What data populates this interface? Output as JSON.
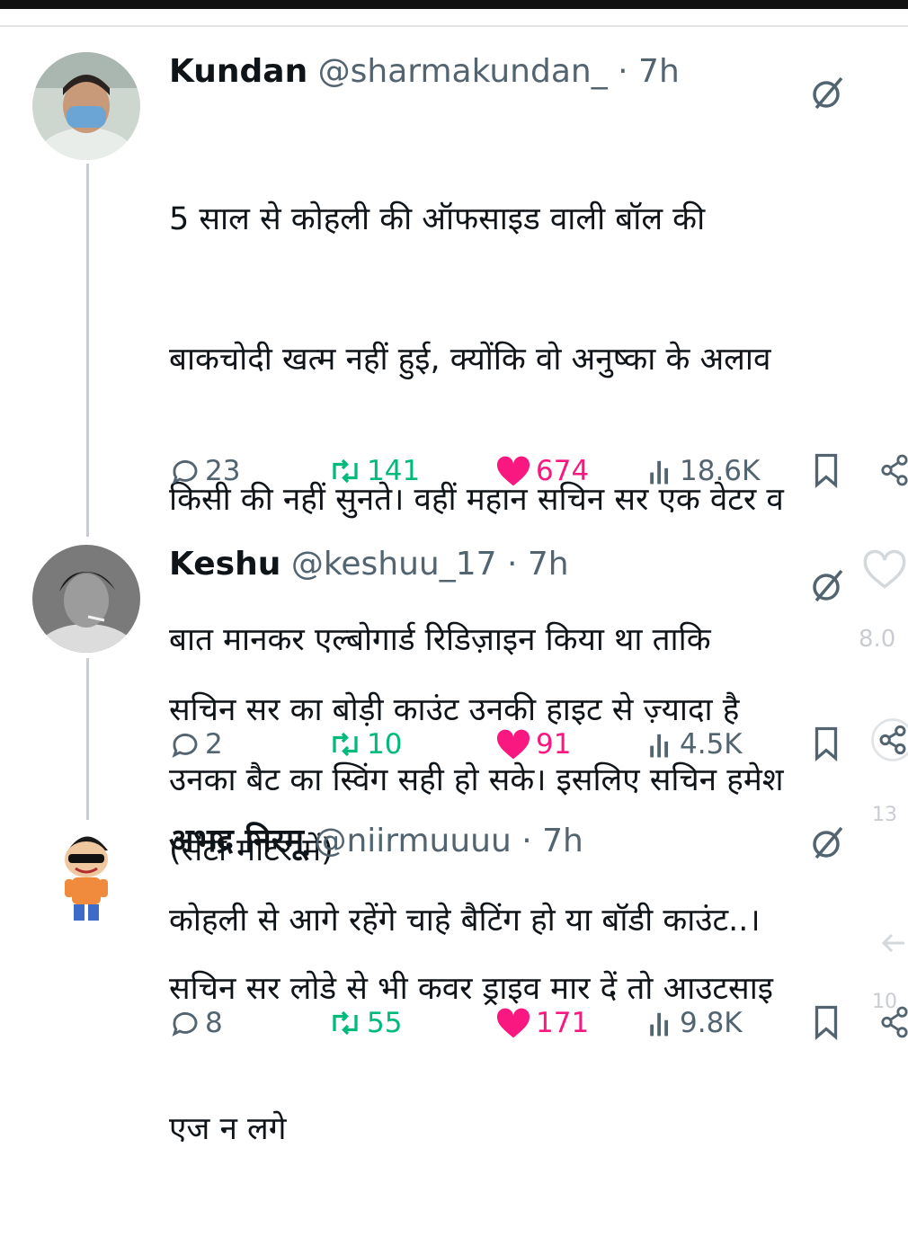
{
  "colors": {
    "like": "#f91880",
    "retweet": "#00ba7c",
    "muted": "#536471",
    "thread_line": "#c9ccd0"
  },
  "tweets": [
    {
      "name": "Kundan",
      "handle": "@sharmakundan_",
      "time": "· 7h",
      "lines": [
        "5 साल से कोहली की ऑफसाइड वाली बॉल की",
        "बाकचोदी खत्म नहीं हुई, क्योंकि वो अनुष्का के अलाव",
        "किसी की नहीं सुनते। वहीं महान सचिन सर एक वेटर व",
        "बात मानकर एल्बोगार्ड रिडिज़ाइन किया था ताकि",
        "उनका बैट का स्विंग सही हो सके। इसलिए सचिन हमेश",
        "कोहली से आगे रहेंगे चाहे बैटिंग हो या बॉडी काउंट..।"
      ],
      "replies": "23",
      "retweets": "141",
      "likes": "674",
      "views": "18.6K"
    },
    {
      "name": "Keshu",
      "handle": "@keshuu_17",
      "time": "· 7h",
      "lines": [
        "सचिन सर का बोड़ी काउंट उनकी हाइट से ज़्यादा है",
        "(सेंटी मीटर में)"
      ],
      "replies": "2",
      "retweets": "10",
      "likes": "91",
      "views": "4.5K"
    },
    {
      "name": "अभद्र निरमू",
      "handle": "@niirmuuuu",
      "time": "· 7h",
      "lines": [
        "सचिन सर लोडे से भी कवर ड्राइव मार दें तो आउटसाइ",
        "एज न लगे"
      ],
      "replies": "8",
      "retweets": "55",
      "likes": "171",
      "views": "9.8K"
    }
  ],
  "edge_overlay": {
    "a": "8.0",
    "b": "13",
    "c": "10"
  }
}
